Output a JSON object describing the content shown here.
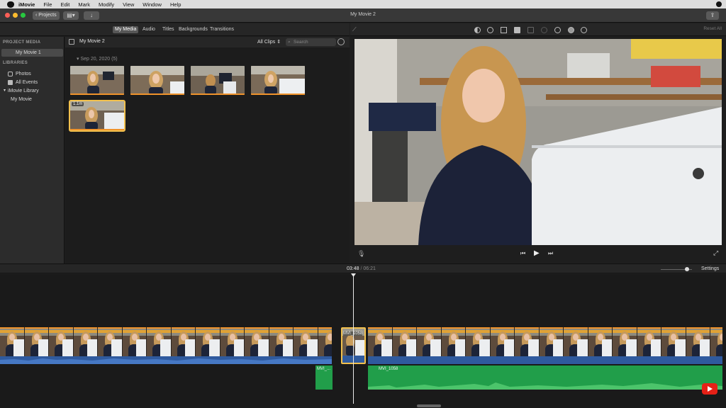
{
  "menubar": {
    "app_name": "iMovie",
    "items": [
      "File",
      "Edit",
      "Mark",
      "Modify",
      "View",
      "Window",
      "Help"
    ]
  },
  "toolbar": {
    "projects_label": "Projects",
    "window_title": "My Movie 2"
  },
  "browser_tabs": [
    "My Media",
    "Audio",
    "Titles",
    "Backgrounds",
    "Transitions"
  ],
  "viewer_toolbar": {
    "reset_label": "Reset All"
  },
  "sidebar": {
    "project_media_heading": "PROJECT MEDIA",
    "project_item": "My Movie 1",
    "libraries_heading": "LIBRARIES",
    "library_items": [
      "Photos",
      "All Events",
      "iMovie Library",
      "My Movie"
    ]
  },
  "browser": {
    "title": "My Movie 2",
    "filter": "All Clips",
    "search_placeholder": "Search",
    "event_date": "Sep 20, 2020",
    "event_count": "(5)",
    "selected_duration": "1.1m"
  },
  "timeline": {
    "current_time": "03:48",
    "separator": "/",
    "total_time": "06:21",
    "settings_label": "Settings",
    "selected_clip_label": "MVI_1058",
    "audio_clip_a_label": "MVI_...",
    "audio_clip_b_label": "MVI_1058",
    "zoom_level": 0.78
  },
  "colors": {
    "accent_orange": "#f0932b",
    "selection_yellow": "#f2c14e",
    "audio_blue": "#2f5a9e",
    "audio_green": "#219e4a"
  }
}
